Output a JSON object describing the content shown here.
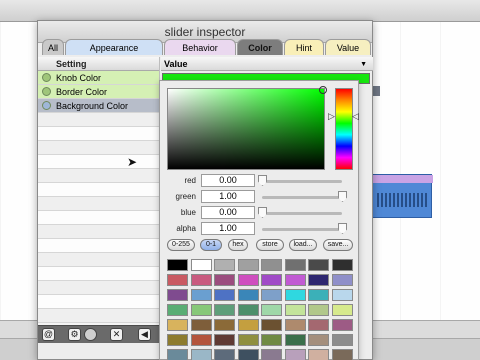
{
  "window": {
    "title": "slider inspector"
  },
  "tabs": [
    {
      "label": "All",
      "bg": "#c9c9c9"
    },
    {
      "label": "Appearance",
      "bg": "#cfe0f5"
    },
    {
      "label": "Behavior",
      "bg": "#ead8ef"
    },
    {
      "label": "Color",
      "bg": "#7d7d7d"
    },
    {
      "label": "Hint",
      "bg": "#f9efb8"
    },
    {
      "label": "Value",
      "bg": "#f6efc0"
    }
  ],
  "table": {
    "setting_header": "Setting",
    "value_header": "Value",
    "rows": [
      {
        "label": "Knob Color",
        "bg": "#d5f0b4",
        "dot": "#9fc57a"
      },
      {
        "label": "Border Color",
        "bg": "#d5f0b4",
        "dot": "#9fc57a"
      },
      {
        "label": "Background Color",
        "bg": "#b7bdc9",
        "dot": "#9fb7d8"
      }
    ]
  },
  "value_color": "#17e60f",
  "picker": {
    "sliders": [
      {
        "label": "red",
        "value": "0.00",
        "pos": 0.0
      },
      {
        "label": "green",
        "value": "1.00",
        "pos": 1.0
      },
      {
        "label": "blue",
        "value": "0.00",
        "pos": 0.0
      },
      {
        "label": "alpha",
        "value": "1.00",
        "pos": 1.0
      }
    ],
    "buttons": [
      {
        "label": "0-255",
        "selected": false
      },
      {
        "label": "0-1",
        "selected": true
      },
      {
        "label": "hex",
        "selected": false
      },
      {
        "label": "store",
        "selected": false
      },
      {
        "label": "load...",
        "selected": false
      },
      {
        "label": "save...",
        "selected": false
      }
    ],
    "swatches": [
      [
        "#000000",
        "#ffffff",
        "#b0b0b0",
        "#a0a0a0",
        "#909090",
        "#707070",
        "#4a4a4a",
        "#2f2f2f"
      ],
      [
        "#c95a62",
        "#c95a7e",
        "#9b4d7e",
        "#cf4fbf",
        "#a04bc7",
        "#c15bd3",
        "#2d2670",
        "#8f8fc9"
      ],
      [
        "#7f4b8f",
        "#6a9fd0",
        "#4e72c4",
        "#3a86b8",
        "#7ea0c9",
        "#2fd8e0",
        "#3bb0b8",
        "#b9d7ec"
      ],
      [
        "#59ad74",
        "#87c879",
        "#5e9e7a",
        "#4d8f6a",
        "#9fd8a8",
        "#c3e49a",
        "#b1c88a",
        "#d6ea8c"
      ],
      [
        "#d8b35d",
        "#7e5e3a",
        "#8b6a38",
        "#c49f3f",
        "#6b5131",
        "#ae8a6d",
        "#a46870",
        "#9d5b85"
      ],
      [
        "#8d7b2d",
        "#b3543c",
        "#5f3a33",
        "#8f8f3f",
        "#6f8a43",
        "#3a6f4a",
        "#a48f7d",
        "#8c8c8c"
      ],
      [
        "#6a8a9a",
        "#9ab7c7",
        "#5d6b7b",
        "#3e5060",
        "#8a7a90",
        "#b8a0bb",
        "#d0b0a0",
        "#7a6a5a"
      ]
    ]
  }
}
